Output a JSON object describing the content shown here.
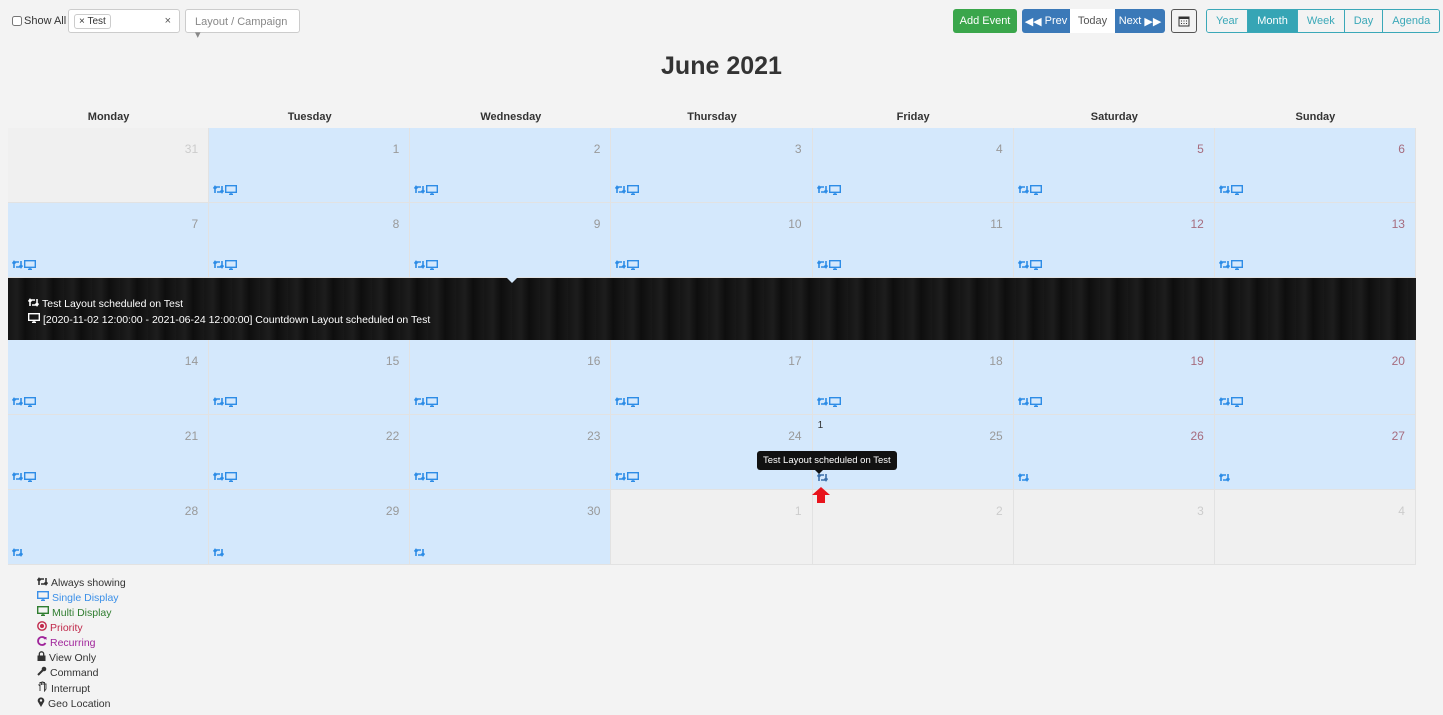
{
  "toolbar": {
    "show_all": "Show All",
    "tag": "Test",
    "tag_remove": "×",
    "tag_clear": "×",
    "layout_placeholder": "Layout / Campaign",
    "add_event": "Add Event",
    "prev": "Prev",
    "today": "Today",
    "next": "Next",
    "views": [
      "Year",
      "Month",
      "Week",
      "Day",
      "Agenda"
    ],
    "active_view": "Month"
  },
  "title": "June 2021",
  "weekdays": [
    "Monday",
    "Tuesday",
    "Wednesday",
    "Thursday",
    "Friday",
    "Saturday",
    "Sunday"
  ],
  "colors": {
    "cell": "#d4e8fc",
    "icon": "#2d8ce6",
    "add": "#3aa64b",
    "nav": "#3b79b8",
    "view": "#36a5b5",
    "weekend": "#a66c7e"
  },
  "weeks": [
    [
      {
        "n": "31",
        "out": true
      },
      {
        "n": "1",
        "i": "rm"
      },
      {
        "n": "2",
        "i": "rm"
      },
      {
        "n": "3",
        "i": "rm"
      },
      {
        "n": "4",
        "i": "rm"
      },
      {
        "n": "5",
        "i": "rm"
      },
      {
        "n": "6",
        "i": "rm"
      }
    ],
    [
      {
        "n": "7",
        "i": "rm"
      },
      {
        "n": "8",
        "i": "rm"
      },
      {
        "n": "9",
        "i": "rm"
      },
      {
        "n": "10",
        "i": "rm"
      },
      {
        "n": "11",
        "i": "rm"
      },
      {
        "n": "12",
        "i": "rm"
      },
      {
        "n": "13",
        "i": "rm"
      }
    ],
    [
      {
        "n": "14",
        "i": "rm"
      },
      {
        "n": "15",
        "i": "rm"
      },
      {
        "n": "16",
        "i": "rm"
      },
      {
        "n": "17",
        "i": "rm"
      },
      {
        "n": "18",
        "i": "rm"
      },
      {
        "n": "19",
        "i": "rm"
      },
      {
        "n": "20",
        "i": "rm"
      }
    ],
    [
      {
        "n": "21",
        "i": "rm"
      },
      {
        "n": "22",
        "i": "rm"
      },
      {
        "n": "23",
        "i": "rm"
      },
      {
        "n": "24",
        "i": "rm"
      },
      {
        "n": "25",
        "i": "r",
        "badge": "1"
      },
      {
        "n": "26",
        "i": "r"
      },
      {
        "n": "27",
        "i": "r"
      }
    ],
    [
      {
        "n": "28",
        "i": "r"
      },
      {
        "n": "29",
        "i": "r"
      },
      {
        "n": "30",
        "i": "r"
      },
      {
        "n": "1",
        "out": true
      },
      {
        "n": "2",
        "out": true
      },
      {
        "n": "3",
        "out": true
      },
      {
        "n": "4",
        "out": true
      }
    ]
  ],
  "event_panel": {
    "events": [
      {
        "icon": "retweet-icon",
        "text": "Test Layout scheduled on Test"
      },
      {
        "icon": "desktop-icon",
        "text": "[2020-11-02 12:00:00 - 2021-06-24 12:00:00] Countdown Layout scheduled on Test"
      }
    ]
  },
  "tooltip": "Test Layout scheduled on Test",
  "legend": [
    {
      "icon": "retweet",
      "label": "Always showing",
      "color": "#333333"
    },
    {
      "icon": "desktop",
      "label": "Single Display",
      "color": "#3a8fe8"
    },
    {
      "icon": "desktop",
      "label": "Multi Display",
      "color": "#2f7d2f"
    },
    {
      "icon": "priority",
      "label": "Priority",
      "color": "#c0284a"
    },
    {
      "icon": "recurring",
      "label": "Recurring",
      "color": "#a0259b"
    },
    {
      "icon": "lock",
      "label": "View Only",
      "color": "#333333"
    },
    {
      "icon": "wrench",
      "label": "Command",
      "color": "#333333"
    },
    {
      "icon": "hand",
      "label": "Interrupt",
      "color": "#333333"
    },
    {
      "icon": "map-marker",
      "label": "Geo Location",
      "color": "#333333"
    }
  ]
}
